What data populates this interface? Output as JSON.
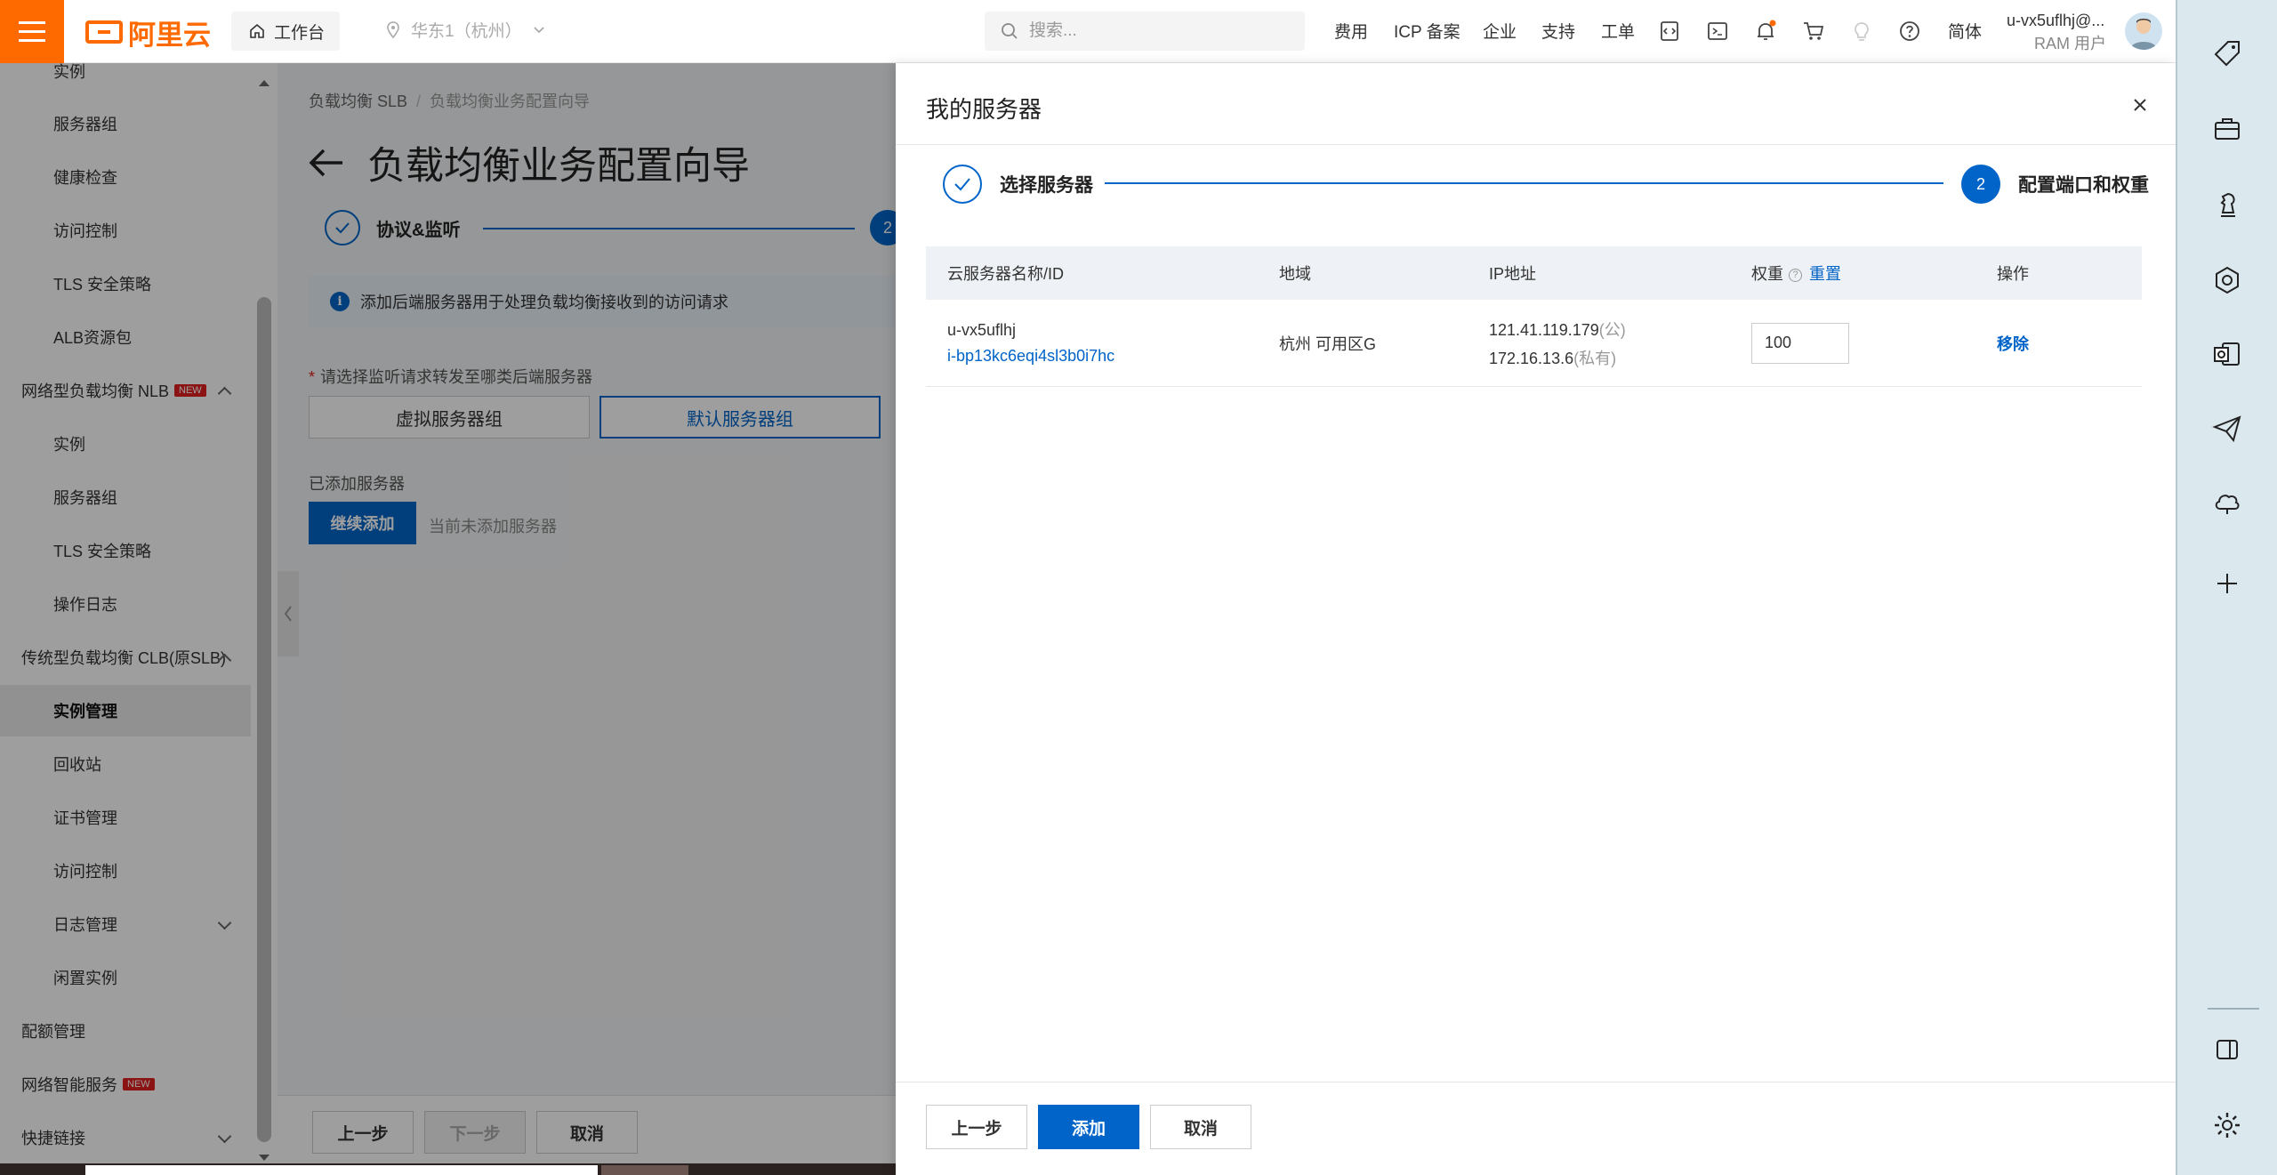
{
  "topbar": {
    "logo_text": "阿里云",
    "workbench_label": "工作台",
    "region_label": "华东1（杭州）",
    "search_placeholder": "搜索...",
    "nav": [
      "费用",
      "ICP 备案",
      "企业",
      "支持",
      "工单"
    ],
    "lang_label": "简体",
    "user_name": "u-vx5uflhj@...",
    "user_role": "RAM 用户",
    "icons": [
      "code-icon",
      "terminal-icon",
      "bell-icon",
      "cart-icon",
      "lightbulb-icon",
      "help-icon"
    ],
    "accent": "#ff6a00"
  },
  "sidebar": {
    "items": [
      {
        "label": "实例",
        "kind": "sub"
      },
      {
        "label": "服务器组",
        "kind": "sub"
      },
      {
        "label": "健康检查",
        "kind": "sub"
      },
      {
        "label": "访问控制",
        "kind": "sub"
      },
      {
        "label": "TLS 安全策略",
        "kind": "sub"
      },
      {
        "label": "ALB资源包",
        "kind": "sub"
      },
      {
        "label": "网络型负载均衡 NLB",
        "kind": "group",
        "badge": "NEW",
        "expanded": true
      },
      {
        "label": "实例",
        "kind": "sub"
      },
      {
        "label": "服务器组",
        "kind": "sub"
      },
      {
        "label": "TLS 安全策略",
        "kind": "sub"
      },
      {
        "label": "操作日志",
        "kind": "sub"
      },
      {
        "label": "传统型负载均衡 CLB(原SLB)",
        "kind": "group",
        "expanded": true
      },
      {
        "label": "实例管理",
        "kind": "sub",
        "active": true
      },
      {
        "label": "回收站",
        "kind": "sub"
      },
      {
        "label": "证书管理",
        "kind": "sub"
      },
      {
        "label": "访问控制",
        "kind": "sub"
      },
      {
        "label": "日志管理",
        "kind": "sub",
        "collapsed": true
      },
      {
        "label": "闲置实例",
        "kind": "sub"
      },
      {
        "label": "配额管理",
        "kind": "group"
      },
      {
        "label": "网络智能服务",
        "kind": "group",
        "badge": "NEW"
      },
      {
        "label": "快捷链接",
        "kind": "group",
        "collapsed": true
      }
    ]
  },
  "page": {
    "breadcrumb": [
      "负载均衡 SLB",
      "负载均衡业务配置向导"
    ],
    "title": "负载均衡业务配置向导",
    "step1_label": "协议&监听",
    "step2_num": "2",
    "info_text": "添加后端服务器用于处理负载均衡接收到的访问请求",
    "hint_text": "请选择监听请求转发至哪类后端服务器",
    "tab_virtual": "虚拟服务器组",
    "tab_default": "默认服务器组",
    "added_label": "已添加服务器",
    "continue_label": "继续添加",
    "not_added_text": "当前未添加服务器",
    "prev_label": "上一步",
    "next_label": "下一步",
    "cancel_label": "取消"
  },
  "drawer": {
    "title": "我的服务器",
    "step1_label": "选择服务器",
    "step2_num": "2",
    "step2_label": "配置端口和权重",
    "headers": {
      "name": "云服务器名称/ID",
      "region": "地域",
      "ip": "IP地址",
      "weight": "权重",
      "reset": "重置",
      "action": "操作"
    },
    "row": {
      "name": "u-vx5uflhj",
      "id": "i-bp13kc6eqi4sl3b0i7hc",
      "zone": "杭州 可用区G",
      "public_ip": "121.41.119.179",
      "public_tag": "(公)",
      "private_ip": "172.16.13.6",
      "private_tag": "(私有)",
      "weight": "100",
      "remove": "移除"
    },
    "footer": {
      "prev": "上一步",
      "add": "添加",
      "cancel": "取消"
    },
    "primary_color": "#0064c8"
  },
  "rail": {
    "icons": [
      "tag-icon",
      "toolbox-icon",
      "chess-icon",
      "hexagon-icon",
      "outlook-icon",
      "send-icon",
      "cloud-icon",
      "plus-icon",
      "sidebar-toggle-icon",
      "settings-icon"
    ]
  }
}
